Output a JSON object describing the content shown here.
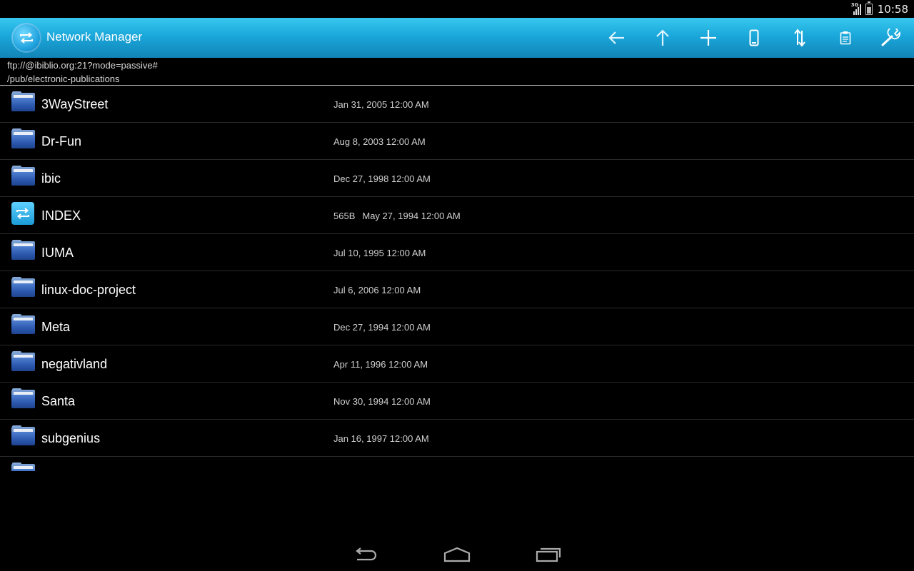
{
  "status_bar": {
    "network": "3G",
    "time": "10:58"
  },
  "action_bar": {
    "title": "Network Manager",
    "actions": [
      {
        "name": "back-arrow-icon"
      },
      {
        "name": "up-arrow-icon"
      },
      {
        "name": "add-icon"
      },
      {
        "name": "phone-icon"
      },
      {
        "name": "transfer-icon"
      },
      {
        "name": "clipboard-icon"
      },
      {
        "name": "wrench-icon"
      }
    ]
  },
  "path": {
    "line1": "ftp://@ibiblio.org:21?mode=passive#",
    "line2": "/pub/electronic-publications"
  },
  "files": [
    {
      "name": "3WayStreet",
      "type": "folder",
      "size": "",
      "date": "Jan 31, 2005 12:00 AM"
    },
    {
      "name": "Dr-Fun",
      "type": "folder",
      "size": "",
      "date": "Aug 8, 2003 12:00 AM"
    },
    {
      "name": "ibic",
      "type": "folder",
      "size": "",
      "date": "Dec 27, 1998 12:00 AM"
    },
    {
      "name": "INDEX",
      "type": "file",
      "size": "565B",
      "date": "May 27, 1994 12:00 AM"
    },
    {
      "name": "IUMA",
      "type": "folder",
      "size": "",
      "date": "Jul 10, 1995 12:00 AM"
    },
    {
      "name": "linux-doc-project",
      "type": "folder",
      "size": "",
      "date": "Jul 6, 2006 12:00 AM"
    },
    {
      "name": "Meta",
      "type": "folder",
      "size": "",
      "date": "Dec 27, 1994 12:00 AM"
    },
    {
      "name": "negativland",
      "type": "folder",
      "size": "",
      "date": "Apr 11, 1996 12:00 AM"
    },
    {
      "name": "Santa",
      "type": "folder",
      "size": "",
      "date": "Nov 30, 1994 12:00 AM"
    },
    {
      "name": "subgenius",
      "type": "folder",
      "size": "",
      "date": "Jan 16, 1997 12:00 AM"
    }
  ],
  "colors": {
    "action_bar_top": "#38c8ef",
    "action_bar_bottom": "#1284b6",
    "folder_blue": "#2b57ad"
  }
}
